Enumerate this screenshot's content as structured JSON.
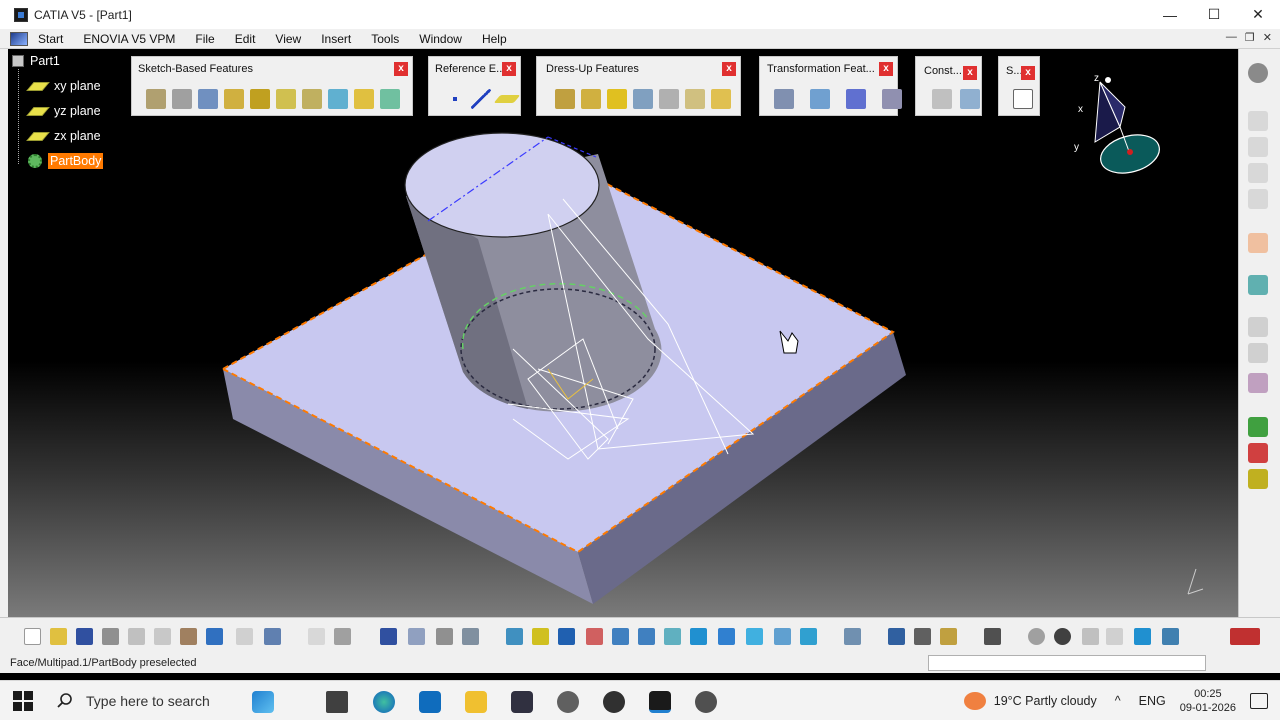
{
  "window": {
    "title": "CATIA V5 - [Part1]",
    "minimize": "—",
    "maximize": "☐",
    "close": "✕"
  },
  "menubar": {
    "items": [
      "Start",
      "ENOVIA V5 VPM",
      "File",
      "Edit",
      "View",
      "Insert",
      "Tools",
      "Window",
      "Help"
    ],
    "mdi_min": "—",
    "mdi_restore": "❐",
    "mdi_close": "✕"
  },
  "tree": {
    "root": "Part1",
    "items": [
      "xy plane",
      "yz plane",
      "zx plane"
    ],
    "body": "PartBody"
  },
  "toolbars": [
    {
      "title": "Sketch-Based Features",
      "icon_count": 10
    },
    {
      "title": "Reference E...",
      "icon_count": 3
    },
    {
      "title": "Dress-Up Features",
      "icon_count": 7
    },
    {
      "title": "Transformation Feat...",
      "icon_count": 4
    },
    {
      "title": "Const...",
      "icon_count": 2
    },
    {
      "title": "S...",
      "icon_count": 1
    }
  ],
  "compass": {
    "x": "x",
    "y": "y",
    "z": "z"
  },
  "statusbar": {
    "text": "Face/Multipad.1/PartBody preselected"
  },
  "taskbar": {
    "search_placeholder": "Type here to search",
    "weather": "19°C  Partly cloudy",
    "language": "ENG",
    "time": "00:25",
    "date": "09-01-2026"
  },
  "colors": {
    "selection": "#ff7a00",
    "part_face": "#c8c8f0",
    "toolbar_bg": "#f0f0f0",
    "close_red": "#e03030"
  }
}
